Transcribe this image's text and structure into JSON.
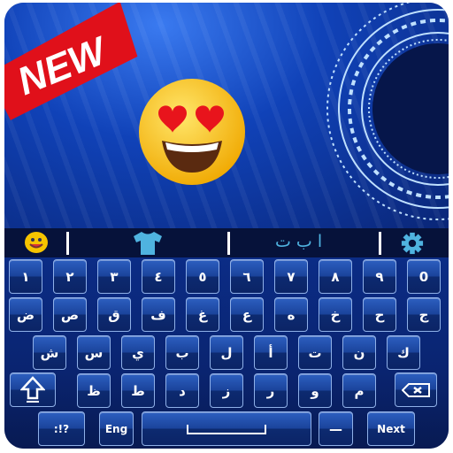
{
  "badge": {
    "text": "NEW",
    "color": "#e0101a"
  },
  "hero": {
    "emoji": "heart-eyes-emoji"
  },
  "toolbar": {
    "items": [
      {
        "icon": "smiley-icon"
      },
      {
        "icon": "tshirt-icon",
        "color": "#4fb3e0"
      },
      {
        "label": "ا ب ت",
        "color": "#4fb3e0"
      },
      {
        "icon": "gear-icon",
        "color": "#4fb3e0"
      }
    ]
  },
  "keyboard": {
    "row1": [
      "١",
      "٢",
      "٣",
      "٤",
      "٥",
      "٦",
      "٧",
      "٨",
      "٩",
      "0"
    ],
    "row2": [
      "ض",
      "ص",
      "ق",
      "ف",
      "غ",
      "ع",
      "ه",
      "خ",
      "ح",
      "ج"
    ],
    "row3": [
      "ش",
      "س",
      "ي",
      "ب",
      "ل",
      "أ",
      "ت",
      "ن",
      "ك"
    ],
    "row4": [
      "ظ",
      "ط",
      "د",
      "ز",
      "ر",
      "و",
      "م"
    ],
    "symbols_label": ":!?",
    "lang_label": "Eng",
    "dash_label": "—",
    "next_label": "Next",
    "shift_icon": "shift-arrow-icon",
    "backspace_icon": "backspace-icon"
  }
}
